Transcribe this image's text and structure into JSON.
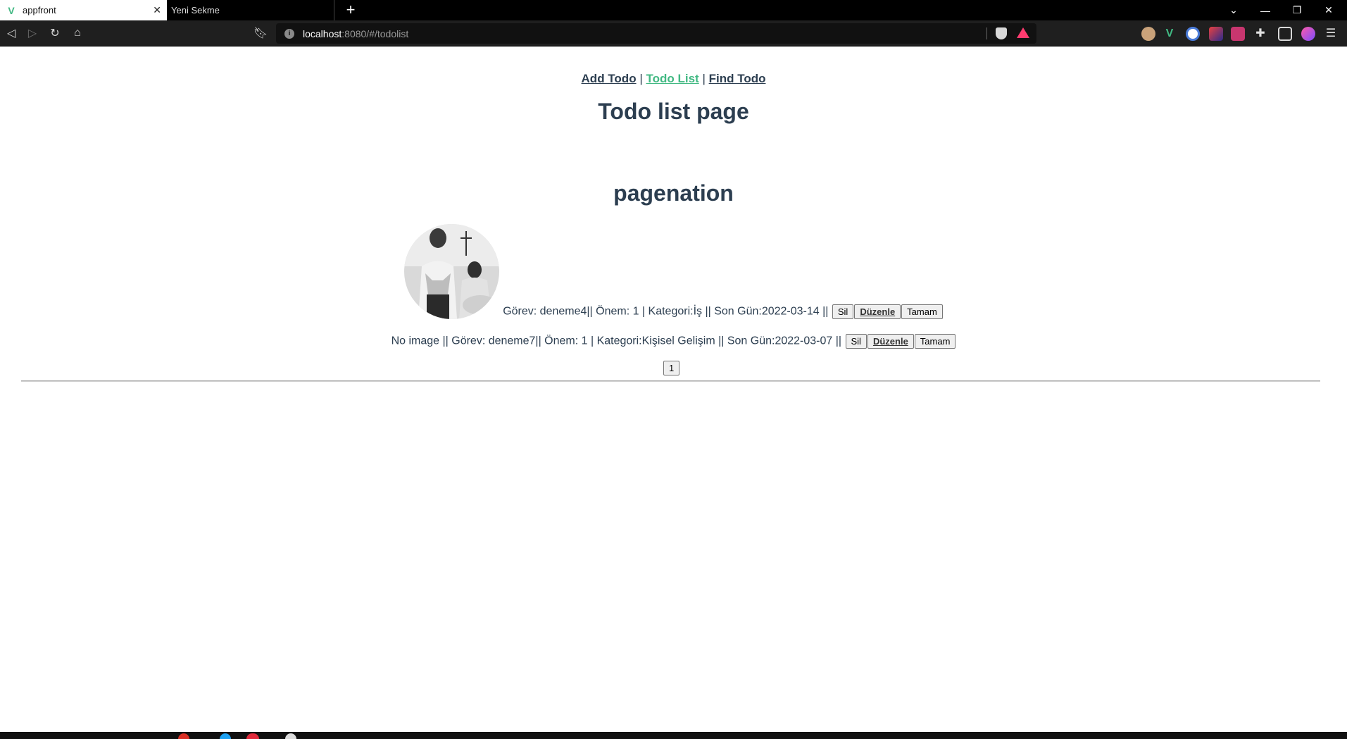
{
  "browser": {
    "tabs": [
      {
        "title": "appfront",
        "active": true
      },
      {
        "title": "Yeni Sekme",
        "active": false
      }
    ],
    "url": {
      "host": "localhost",
      "rest": ":8080/#/todolist"
    }
  },
  "nav": {
    "add_todo": "Add Todo",
    "todo_list": "Todo List",
    "find_todo": "Find Todo",
    "separator": "|"
  },
  "page": {
    "title": "Todo list page",
    "subtitle": "pagenation"
  },
  "todos": [
    {
      "text": "Görev: deneme4|| Önem: 1 | Kategori:İş || Son Gün:2022-03-14 ||",
      "has_image": true,
      "buttons": {
        "delete": "Sil",
        "edit": "Düzenle",
        "done": "Tamam"
      }
    },
    {
      "text": "No image || Görev: deneme7|| Önem: 1 | Kategori:Kişisel Gelişim || Son Gün:2022-03-07 ||",
      "has_image": false,
      "buttons": {
        "delete": "Sil",
        "edit": "Düzenle",
        "done": "Tamam"
      }
    }
  ],
  "pagination": {
    "pages": [
      "1"
    ]
  },
  "colors": {
    "text": "#2c3e50",
    "active_link": "#42b983"
  }
}
